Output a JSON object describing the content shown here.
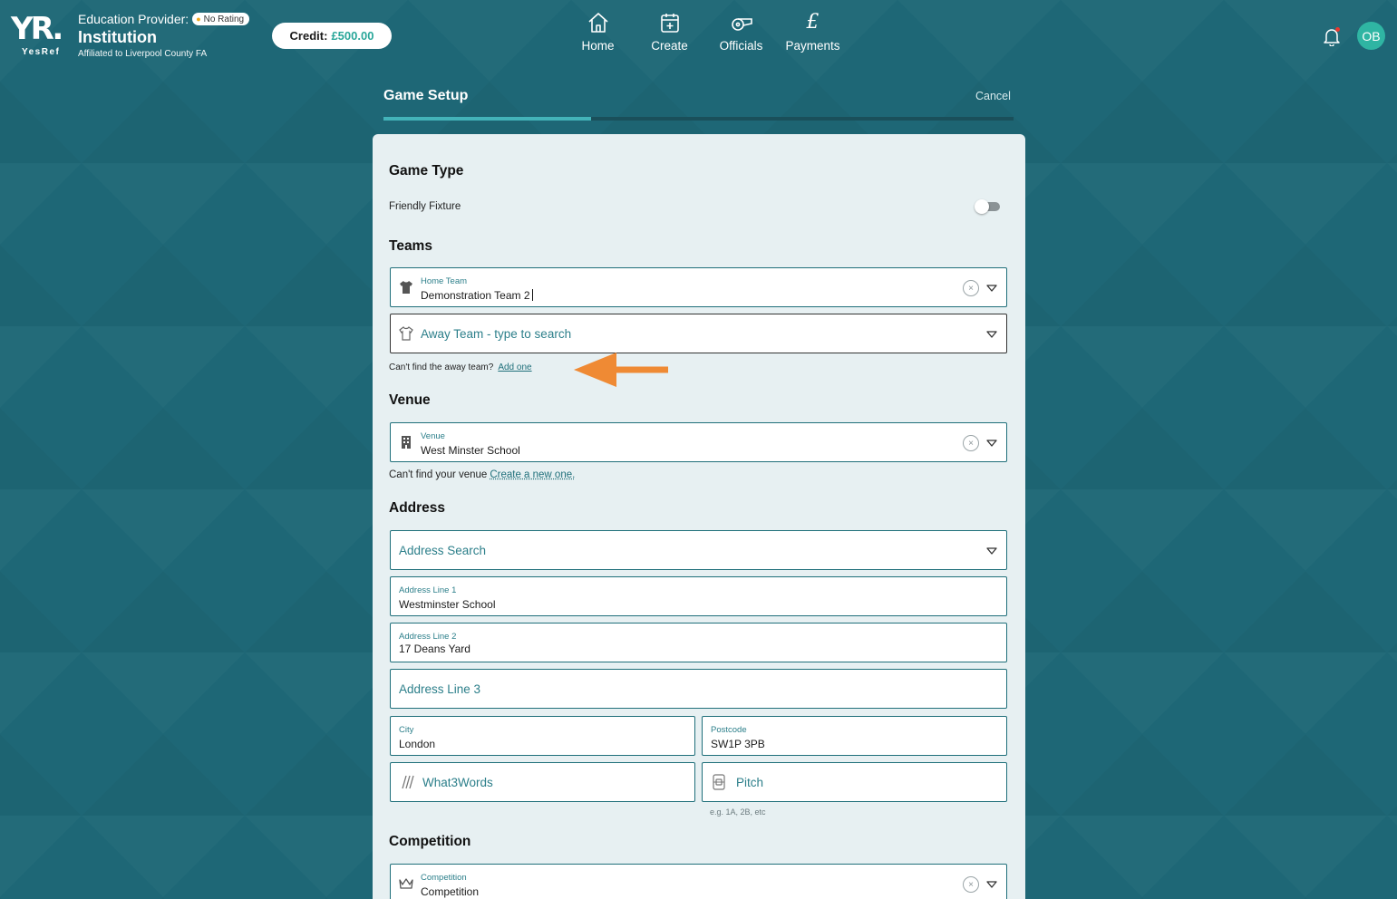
{
  "header": {
    "logo_text": "YR.",
    "logo_sub": "YesRef",
    "provider_label": "Education Provider:",
    "rating_badge": "No Rating",
    "institution": "Institution",
    "affiliation": "Affiliated to Liverpool County FA",
    "credit_label": "Credit:",
    "credit_amount": "£500.00",
    "nav": [
      {
        "label": "Home",
        "icon": "home-icon"
      },
      {
        "label": "Create",
        "icon": "calendar-plus-icon"
      },
      {
        "label": "Officials",
        "icon": "whistle-icon"
      },
      {
        "label": "Payments",
        "icon": "pound-icon"
      }
    ],
    "pound_symbol": "£",
    "avatar_initials": "OB"
  },
  "setup": {
    "title": "Game Setup",
    "cancel_label": "Cancel",
    "progress": 0.33
  },
  "form": {
    "game_type_title": "Game Type",
    "friendly_label": "Friendly Fixture",
    "friendly_enabled": false,
    "teams_title": "Teams",
    "home_team_label": "Home Team",
    "home_team_value": "Demonstration Team 2",
    "away_team_placeholder": "Away Team - type to search",
    "away_hint": "Can't find the away team?",
    "away_hint_link": "Add one",
    "venue_title": "Venue",
    "venue_label": "Venue",
    "venue_value": "West Minster School",
    "venue_hint": "Can't find your venue",
    "venue_hint_link": "Create a new one.",
    "address_title": "Address",
    "address_search_placeholder": "Address Search",
    "address_line1_label": "Address Line 1",
    "address_line1_value": "Westminster School",
    "address_line2_label": "Address Line 2",
    "address_line2_value": "17 Deans Yard",
    "address_line3_placeholder": "Address Line 3",
    "city_label": "City",
    "city_value": "London",
    "postcode_label": "Postcode",
    "postcode_value": "SW1P 3PB",
    "what3words_placeholder": "What3Words",
    "pitch_placeholder": "Pitch",
    "pitch_hint": "e.g. 1A, 2B, etc",
    "competition_title": "Competition",
    "competition_label": "Competition",
    "competition_value": "Competition",
    "clear_symbol": "×"
  },
  "colors": {
    "background": "#1e6776",
    "accent": "#43b3b9",
    "credit_amount": "#2aa79a",
    "annotation_arrow": "#ef8a34"
  }
}
